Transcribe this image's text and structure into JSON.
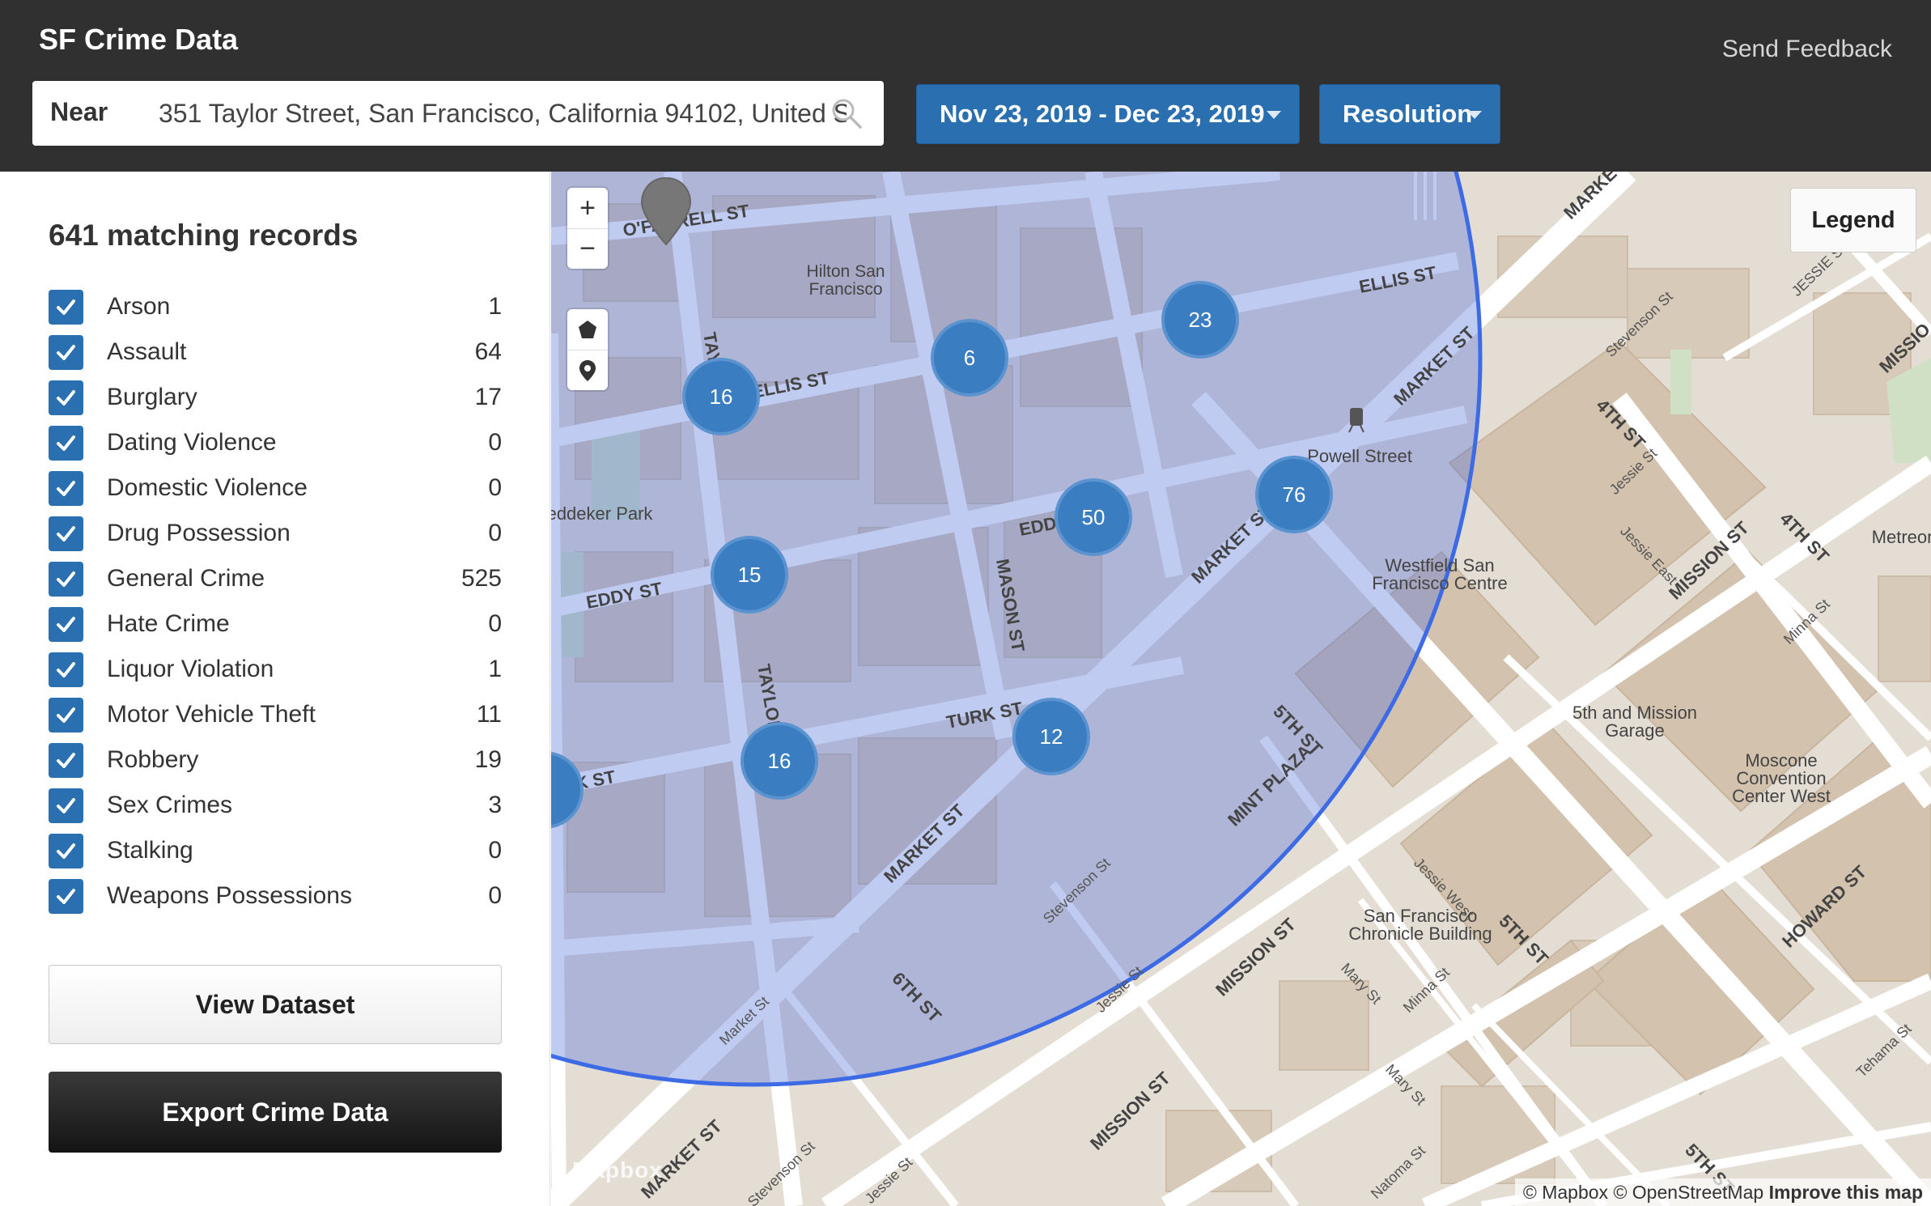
{
  "header": {
    "title": "SF Crime Data",
    "send_feedback": "Send Feedback",
    "search": {
      "label": "Near",
      "value": "351 Taylor Street, San Francisco, California 94102, United States"
    },
    "date_range": "Nov 23, 2019 - Dec 23, 2019",
    "resolution": "Resolution"
  },
  "sidebar": {
    "records_count": "641 matching records",
    "categories": [
      {
        "label": "Arson",
        "count": "1",
        "checked": true
      },
      {
        "label": "Assault",
        "count": "64",
        "checked": true
      },
      {
        "label": "Burglary",
        "count": "17",
        "checked": true
      },
      {
        "label": "Dating Violence",
        "count": "0",
        "checked": true
      },
      {
        "label": "Domestic Violence",
        "count": "0",
        "checked": true
      },
      {
        "label": "Drug Possession",
        "count": "0",
        "checked": true
      },
      {
        "label": "General Crime",
        "count": "525",
        "checked": true
      },
      {
        "label": "Hate Crime",
        "count": "0",
        "checked": true
      },
      {
        "label": "Liquor Violation",
        "count": "1",
        "checked": true
      },
      {
        "label": "Motor Vehicle Theft",
        "count": "11",
        "checked": true
      },
      {
        "label": "Robbery",
        "count": "19",
        "checked": true
      },
      {
        "label": "Sex Crimes",
        "count": "3",
        "checked": true
      },
      {
        "label": "Stalking",
        "count": "0",
        "checked": true
      },
      {
        "label": "Weapons Possessions",
        "count": "0",
        "checked": true
      }
    ],
    "view_dataset": "View Dataset",
    "export": "Export Crime Data"
  },
  "map": {
    "zoom_in": "+",
    "zoom_out": "−",
    "legend": "Legend",
    "attribution": {
      "mapbox": "© Mapbox",
      "osm": "© OpenStreetMap",
      "improve": "Improve this map"
    },
    "logo": "Mapbox",
    "clusters": [
      "16",
      "6",
      "23",
      "50",
      "76",
      "15",
      "12",
      "16"
    ],
    "street_labels": [
      "O'FARRELL ST",
      "ELLIS ST",
      "ELLIS ST",
      "EDDY ST",
      "EDDY ST",
      "TURK ST",
      "URK ST",
      "TAYLOR ST",
      "TAYLOR",
      "MASON ST",
      "MARKET ST",
      "MARKET ST",
      "MARKET ST",
      "MARKET ST",
      "MARKE",
      "4TH ST",
      "4TH ST",
      "5TH ST",
      "5TH ST",
      "5TH ST",
      "6TH ST",
      "MISSION ST",
      "MISSION ST",
      "MISSION ST",
      "MISSION ST",
      "MISSIO",
      "HOWARD ST",
      "MINT PLAZA",
      "Stevenson St",
      "Stevenson St",
      "Stevenson St",
      "Jessie St",
      "Jessie St",
      "Jessie St",
      "Jessie St",
      "JESSIE ST",
      "Jessie East",
      "Jessie West",
      "Minna St",
      "Minna St",
      "Mary St",
      "Mary St",
      "Natoma St",
      "Tehama St",
      "Market St"
    ],
    "place_labels": [
      "Hilton San Francisco",
      "Powell Street",
      "Westfield San Francisco Centre",
      "5th and Mission Garage",
      "Moscone Convention Center West",
      "San Francisco Chronicle Building",
      "Metreon",
      "eddeker Park"
    ],
    "colors": {
      "cluster": "#3a7dc0",
      "radius_stroke": "#3d6be6",
      "radius_fill": "rgba(80,110,220,0.35)",
      "land": "#e4ddd3",
      "building": "#d9cbb9",
      "road": "#ffffff"
    }
  }
}
